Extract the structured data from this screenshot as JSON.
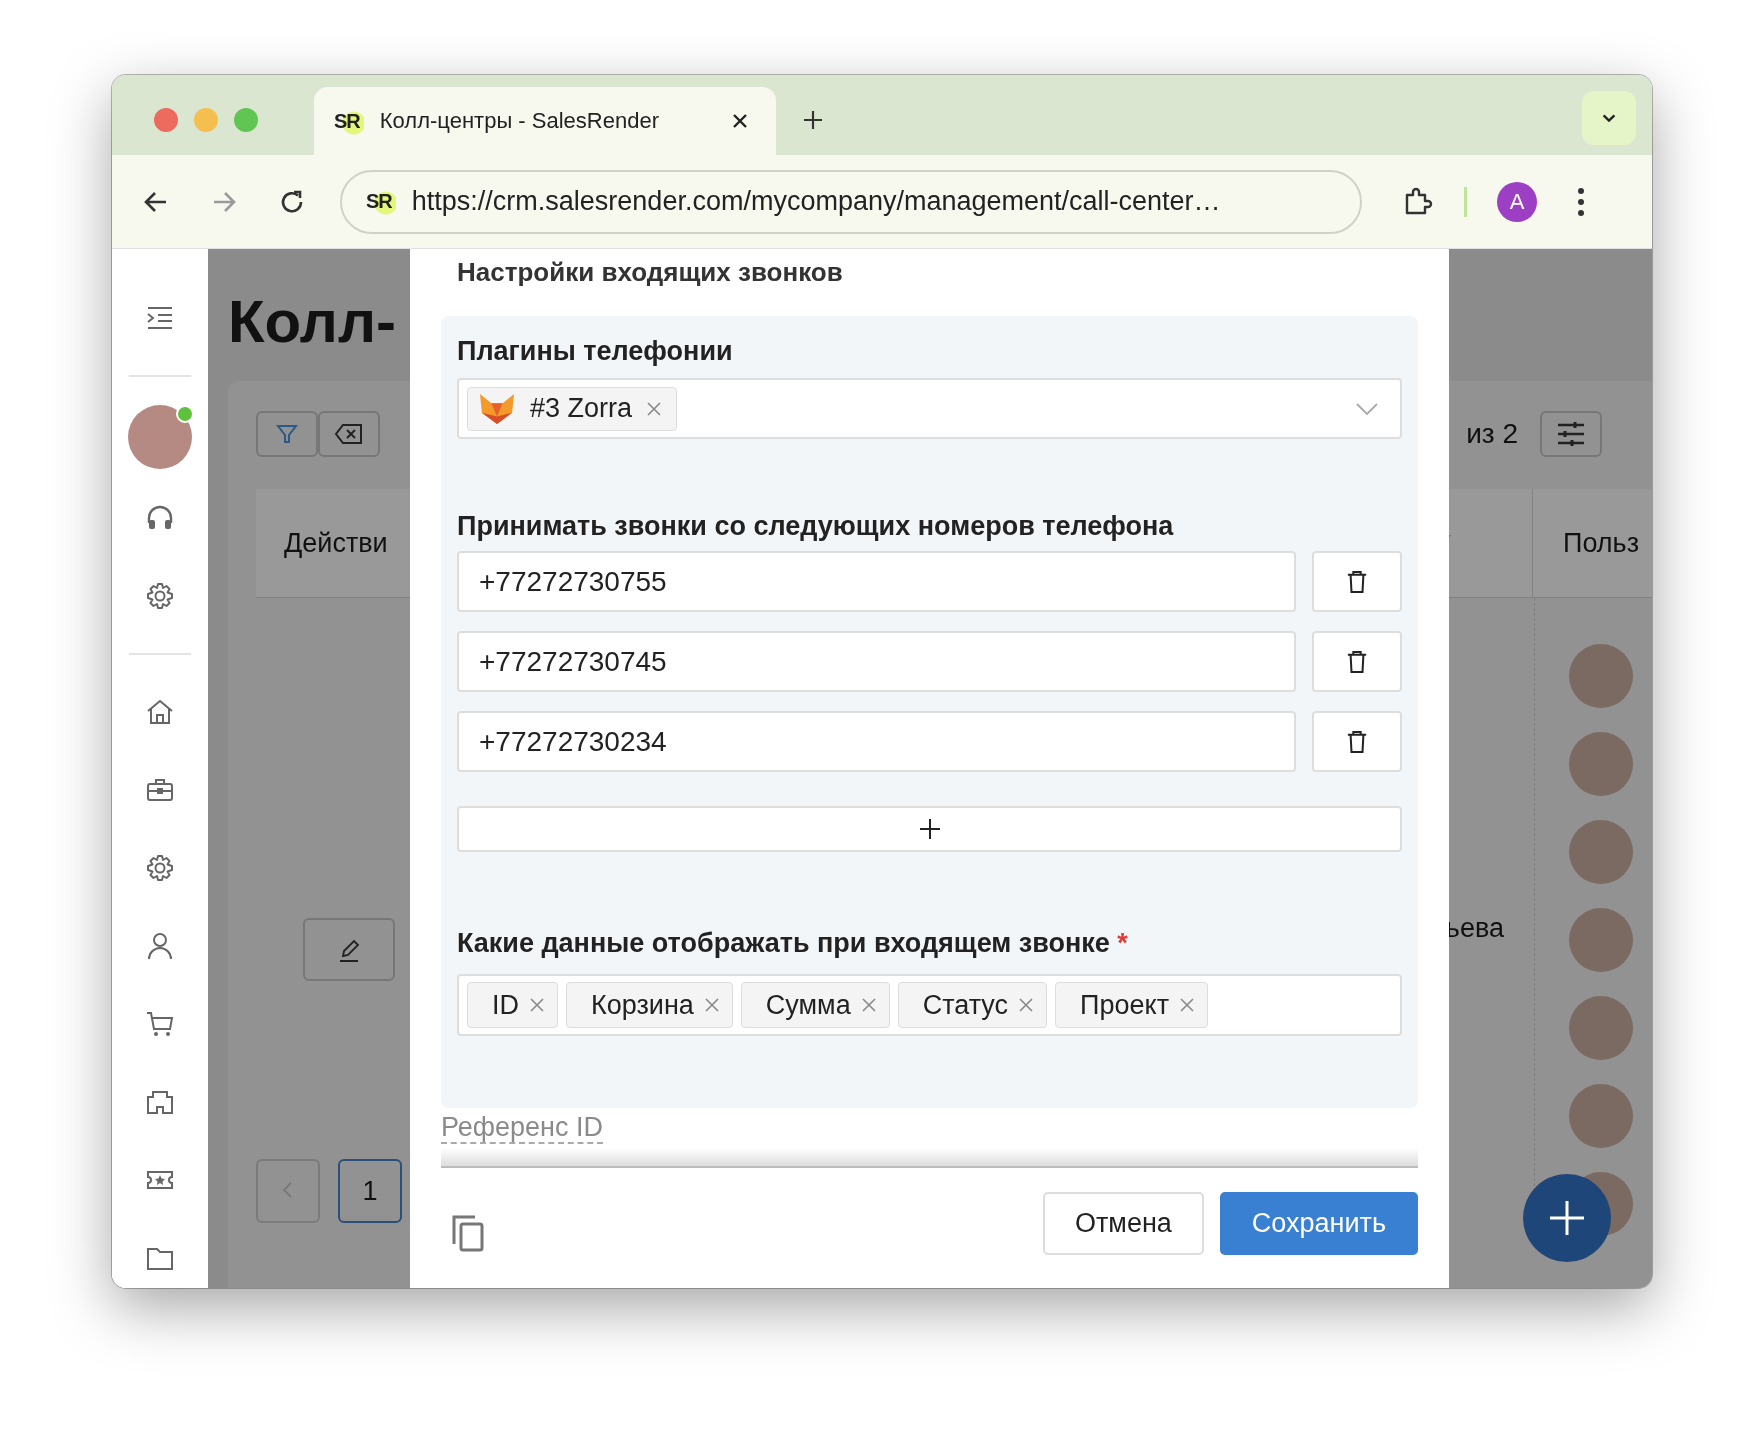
{
  "browser": {
    "tab": {
      "favicon": "SR",
      "title": "Колл-центры - SalesRender",
      "selected": true
    },
    "address": {
      "favicon": "SR",
      "url": "https://crm.salesrender.com/mycompany/management/call-center…"
    },
    "profile_initial": "A"
  },
  "sidebar": {
    "user_online": true
  },
  "background_page": {
    "title": "Колл-",
    "pages_text": "из 2",
    "column_1": "Действи",
    "column_2": "Польз",
    "cell_text": "ьева",
    "page_number": "1"
  },
  "modal": {
    "section_title": "Настройки входящих звонков",
    "plugins_label": "Плагины телефонии",
    "plugins": [
      {
        "label": "#3 Zorra"
      }
    ],
    "numbers_label": "Принимать звонки со следующих номеров телефона",
    "numbers": [
      "+77272730755",
      "+77272730745",
      "+77272730234"
    ],
    "display_label": "Какие данные отображать при входящем звонке",
    "required_mark": "*",
    "display_tags": [
      "ID",
      "Корзина",
      "Сумма",
      "Статус",
      "Проект"
    ],
    "reference_label": "Референс ID",
    "cancel": "Отмена",
    "save": "Сохранить"
  }
}
